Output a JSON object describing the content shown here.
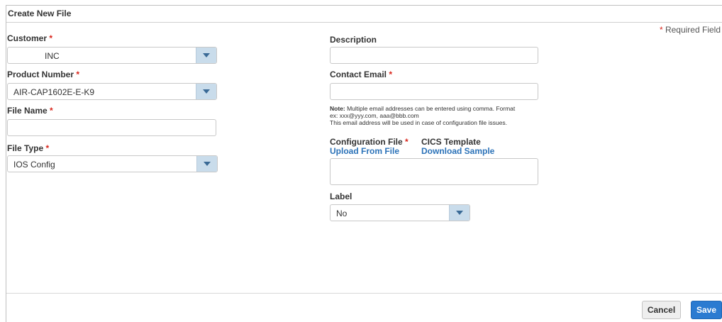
{
  "header": {
    "title": "Create New File"
  },
  "required_note": {
    "star": "*",
    "text": "Required Field"
  },
  "left": {
    "customer": {
      "label": "Customer",
      "star": "*",
      "value": "INC"
    },
    "product_number": {
      "label": "Product Number",
      "star": "*",
      "value": "AIR-CAP1602E-E-K9"
    },
    "file_name": {
      "label": "File Name",
      "star": "*",
      "value": ""
    },
    "file_type": {
      "label": "File Type",
      "star": "*",
      "value": "IOS Config"
    }
  },
  "right": {
    "description": {
      "label": "Description",
      "value": ""
    },
    "contact_email": {
      "label": "Contact Email",
      "star": "*",
      "value": ""
    },
    "note": {
      "prefix": "Note:",
      "line1": " Multiple email addresses can be entered using comma. Format",
      "line2": "ex: xxx@yyy.com, aaa@bbb.com",
      "line3": "This email address will be used in case of configuration file issues."
    },
    "config_file": {
      "label": "Configuration File",
      "star": "*",
      "link": "Upload From File"
    },
    "cics_template": {
      "label": "CICS Template",
      "link": "Download Sample"
    },
    "label_field": {
      "label": "Label",
      "value": "No"
    }
  },
  "footer": {
    "cancel": "Cancel",
    "save": "Save"
  },
  "icons": {
    "dropdown": "chevron-down-icon"
  },
  "colors": {
    "required": "#d9261c",
    "link": "#2b72b8",
    "primary": "#2b7bd1",
    "dropdown_button": "#c9dceb"
  }
}
